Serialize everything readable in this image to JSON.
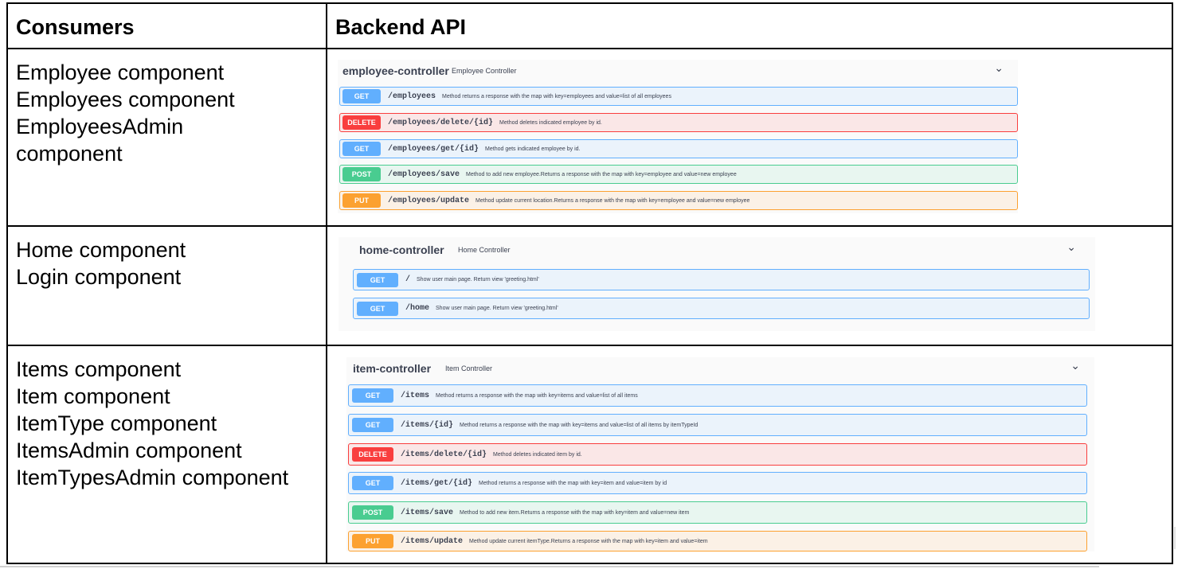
{
  "table": {
    "headers": {
      "consumers": "Consumers",
      "backend": "Backend API"
    },
    "rows": [
      {
        "consumers": [
          "Employee component",
          "Employees component",
          "EmployeesAdmin",
          "component"
        ],
        "controller": {
          "name": "employee-controller",
          "description": "Employee Controller",
          "operations": [
            {
              "method": "GET",
              "path": "/employees",
              "summary": "Method returns a response with the map with key=employees and value=list of all employees"
            },
            {
              "method": "DELETE",
              "path": "/employees/delete/{id}",
              "summary": "Method deletes indicated employee by id."
            },
            {
              "method": "GET",
              "path": "/employees/get/{id}",
              "summary": "Method gets indicated employee by id."
            },
            {
              "method": "POST",
              "path": "/employees/save",
              "summary": "Method to add new employee.Returns a response with the map with key=employee and value=new employee"
            },
            {
              "method": "PUT",
              "path": "/employees/update",
              "summary": "Method update current location.Returns a response with the map with key=employee and value=new employee"
            }
          ]
        }
      },
      {
        "consumers": [
          "Home component",
          "Login component"
        ],
        "controller": {
          "name": "home-controller",
          "description": "Home Controller",
          "operations": [
            {
              "method": "GET",
              "path": "/",
              "summary": "Show user main page. Return view 'greeting.html'"
            },
            {
              "method": "GET",
              "path": "/home",
              "summary": "Show user main page. Return view 'greeting.html'"
            }
          ]
        }
      },
      {
        "consumers": [
          "Items component",
          "Item component",
          "ItemType component",
          "ItemsAdmin component",
          "ItemTypesAdmin component"
        ],
        "controller": {
          "name": "item-controller",
          "description": "Item Controller",
          "operations": [
            {
              "method": "GET",
              "path": "/items",
              "summary": "Method returns a response with the map with key=items and value=list of all items"
            },
            {
              "method": "GET",
              "path": "/items/{id}",
              "summary": "Method returns a response with the map with key=items and value=list of all items by itemTypeId"
            },
            {
              "method": "DELETE",
              "path": "/items/delete/{id}",
              "summary": "Method deletes indicated item by id."
            },
            {
              "method": "GET",
              "path": "/items/get/{id}",
              "summary": "Method returns a response with the map with key=item and value=item by id"
            },
            {
              "method": "POST",
              "path": "/items/save",
              "summary": "Method to add new item.Returns a response with the map with key=item and value=new item"
            },
            {
              "method": "PUT",
              "path": "/items/update",
              "summary": "Method update current itemType.Returns a response with the map with key=item and value=item"
            }
          ]
        }
      }
    ]
  },
  "colors": {
    "GET": "#61affe",
    "DELETE": "#f93e3e",
    "POST": "#49cc90",
    "PUT": "#fca130"
  },
  "icons": {
    "expand": "chevron-down-icon"
  }
}
